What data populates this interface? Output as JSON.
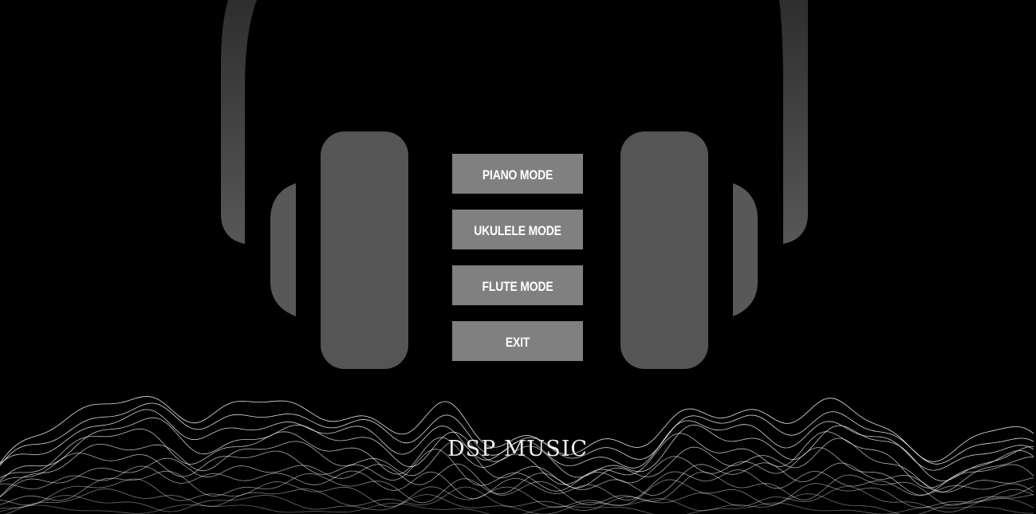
{
  "app": {
    "brand": "DSP MUSIC"
  },
  "menu": {
    "items": [
      {
        "label": "PIANO MODE"
      },
      {
        "label": "UKULELE MODE"
      },
      {
        "label": "FLUTE MODE"
      },
      {
        "label": "EXIT"
      }
    ]
  },
  "colors": {
    "background": "#000000",
    "button": "#808080",
    "headphone": "#555555",
    "text": "#ffffff",
    "wave": "#ffffff"
  },
  "icons": {
    "background_art": "headphones-icon",
    "footer_art": "sound-wave-icon"
  }
}
